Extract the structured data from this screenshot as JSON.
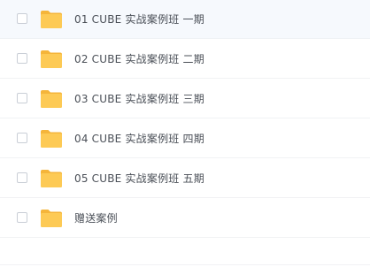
{
  "file_list": {
    "items": [
      {
        "name": "01 CUBE 实战案例班 一期",
        "type": "folder",
        "icon": "folder-icon",
        "checked": false
      },
      {
        "name": "02 CUBE 实战案例班 二期",
        "type": "folder",
        "icon": "folder-icon",
        "checked": false
      },
      {
        "name": "03 CUBE 实战案例班 三期",
        "type": "folder",
        "icon": "folder-icon",
        "checked": false
      },
      {
        "name": "04 CUBE 实战案例班 四期",
        "type": "folder",
        "icon": "folder-icon",
        "checked": false
      },
      {
        "name": "05 CUBE 实战案例班 五期",
        "type": "folder",
        "icon": "folder-icon",
        "checked": false
      },
      {
        "name": "赠送案例",
        "type": "folder",
        "icon": "folder-icon",
        "checked": false
      }
    ]
  },
  "colors": {
    "folder": "#fcc64f",
    "folder_back": "#f5b53a",
    "text": "#4a4f57",
    "hover_row": "#f6f9fd"
  }
}
